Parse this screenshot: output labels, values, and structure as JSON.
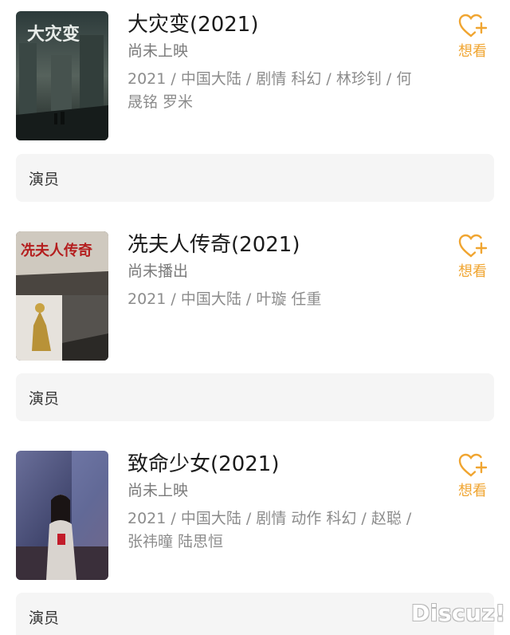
{
  "colors": {
    "accent": "#f0a531",
    "cast_bg": "#f5f5f5",
    "meta": "#8c8c8c"
  },
  "movies": [
    {
      "title": "大灾变",
      "year": "(2021)",
      "status": "尚未上映",
      "meta": "2021 / 中国大陆 / 剧情 科幻 / 林珍钊 / 何晟铭 罗米",
      "want_label": "想看",
      "want_icon": "heart-plus-icon",
      "cast_label": "演员"
    },
    {
      "title": "冼夫人传奇",
      "year": "(2021)",
      "status": "尚未播出",
      "meta": "2021 / 中国大陆 / 叶璇 任重",
      "want_label": "想看",
      "want_icon": "heart-plus-icon",
      "cast_label": "演员"
    },
    {
      "title": "致命少女",
      "year": "(2021)",
      "status": "尚未上映",
      "meta": "2021 / 中国大陆 / 剧情 动作 科幻 / 赵聪 / 张祎曈 陆思恒",
      "want_label": "想看",
      "want_icon": "heart-plus-icon",
      "cast_label": "演员"
    }
  ],
  "watermark": "Discuz!"
}
